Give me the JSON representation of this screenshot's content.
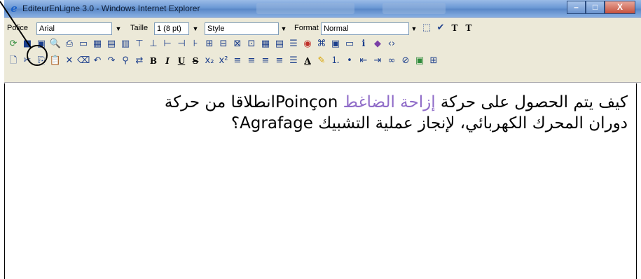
{
  "window": {
    "title": "EditeurEnLigne 3.0 - Windows Internet Explorer",
    "caption_buttons": {
      "minimize": "–",
      "maximize": "□",
      "close": "X"
    }
  },
  "toolbar": {
    "font_label": "Police",
    "font_value": "Arial",
    "size_label": "Taille",
    "size_value": "1 (8 pt)",
    "style_value": "Style",
    "format_label": "Format",
    "format_value": "Normal"
  },
  "editor": {
    "line1_part1": "كيف يتم الحصول على حركة ",
    "line1_highlight": "إزاحة الضاغط",
    "line1_part2": " Poinçonانطلاقا من حركة",
    "line2": "دوران المحرك الكهربائي، لإنجاز عملية التشبيك Agrafage؟"
  },
  "colors": {
    "highlight": "#8f6bc8",
    "titlebar": "#6d9ad6",
    "toolbar_bg": "#ece9d8"
  }
}
